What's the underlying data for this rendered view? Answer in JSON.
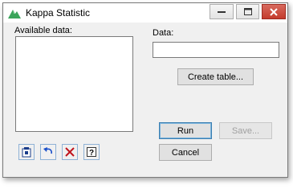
{
  "window": {
    "title": "Kappa Statistic",
    "icon": "green-mountain-icon"
  },
  "titlebar_buttons": [
    "minimize-icon",
    "maximize-icon",
    "close-icon"
  ],
  "left_panel": {
    "available_label": "Available data:"
  },
  "right_panel": {
    "data_label": "Data:",
    "data_value": ""
  },
  "buttons": {
    "create_table": "Create table...",
    "run": "Run",
    "save": "Save...",
    "cancel": "Cancel"
  },
  "bottom_icons": [
    "clipboard-pin-icon",
    "undo-icon",
    "clear-icon",
    "help-icon"
  ]
}
